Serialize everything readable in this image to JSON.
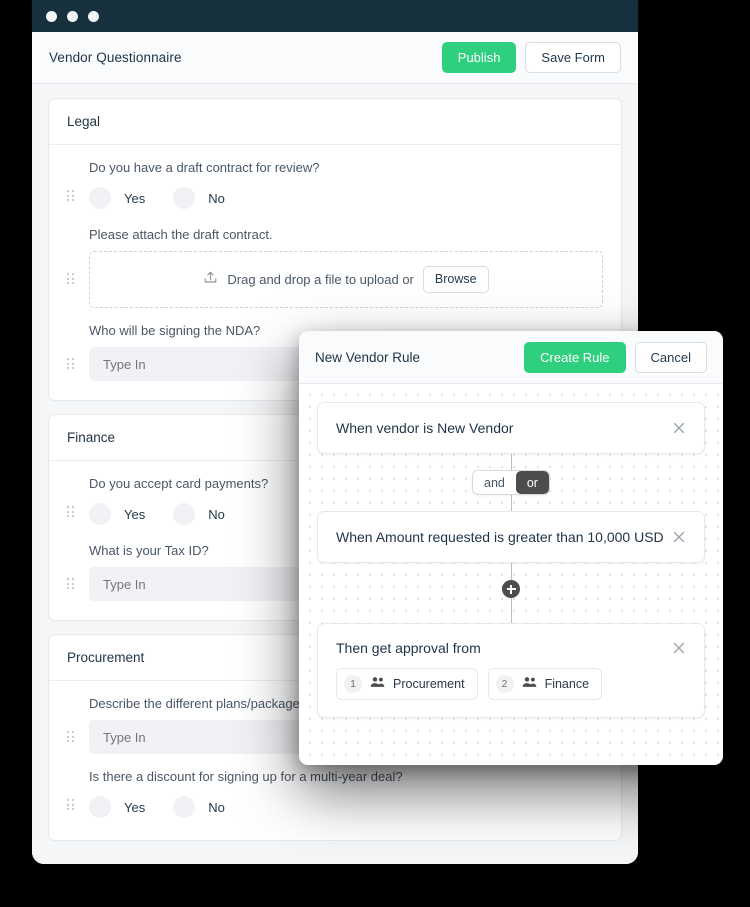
{
  "window": {
    "traffic_lights": [
      "close-dot",
      "minimize-dot",
      "maximize-dot"
    ]
  },
  "toolbar": {
    "title": "Vendor Questionnaire",
    "publish_label": "Publish",
    "save_label": "Save Form"
  },
  "colors": {
    "accent_green": "#2ecf7e",
    "titlebar_navy": "#16303d",
    "toggle_active": "#4d4d4d",
    "canvas_gray": "#f4f6f8",
    "input_gray": "#f0f2f5"
  },
  "form": {
    "sections": [
      {
        "title": "Legal",
        "fields": [
          {
            "kind": "radio",
            "label": "Do you have a draft contract for review?",
            "options": [
              "Yes",
              "No"
            ]
          },
          {
            "kind": "upload",
            "label": "Please attach the draft contract.",
            "dropzone_text": "Drag and drop a file to upload or",
            "browse_label": "Browse"
          },
          {
            "kind": "text",
            "label": "Who will be signing the NDA?",
            "placeholder": "Type In",
            "value": ""
          }
        ]
      },
      {
        "title": "Finance",
        "fields": [
          {
            "kind": "radio",
            "label": "Do you accept card payments?",
            "options": [
              "Yes",
              "No"
            ]
          },
          {
            "kind": "text",
            "label": "What is your Tax ID?",
            "placeholder": "Type In",
            "value": ""
          }
        ]
      },
      {
        "title": "Procurement",
        "fields": [
          {
            "kind": "text",
            "label": "Describe the different plans/packages",
            "placeholder": "Type In",
            "value": ""
          },
          {
            "kind": "radio",
            "label": "Is there a discount for signing up for a multi-year deal?",
            "options": [
              "Yes",
              "No"
            ]
          }
        ]
      }
    ]
  },
  "rule_modal": {
    "title": "New Vendor Rule",
    "create_label": "Create Rule",
    "cancel_label": "Cancel",
    "conditions": [
      {
        "text": "When vendor is New Vendor"
      },
      {
        "text": "When Amount requested is greater than 10,000 USD"
      }
    ],
    "logic_toggle": {
      "options": [
        "and",
        "or"
      ],
      "selected": "or"
    },
    "action": {
      "title": "Then get approval from",
      "approvers": [
        {
          "order": "1",
          "name": "Procurement"
        },
        {
          "order": "2",
          "name": "Finance"
        }
      ]
    }
  }
}
